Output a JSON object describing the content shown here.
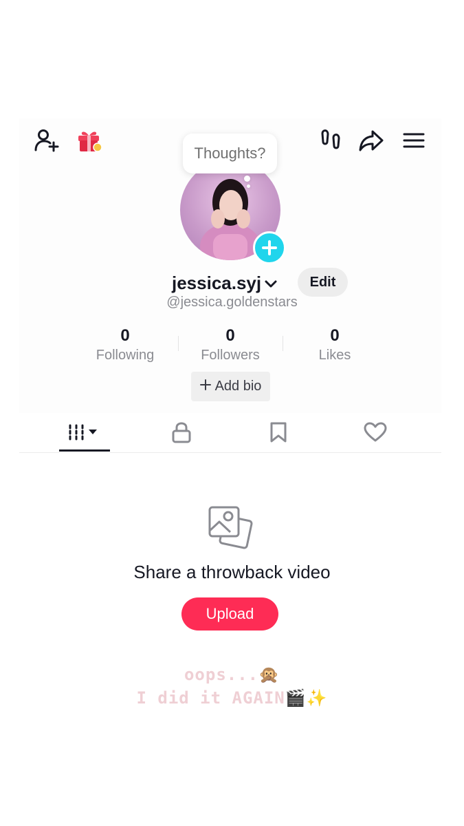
{
  "profile": {
    "thought_bubble": "Thoughts?",
    "username": "jessica.syj",
    "handle": "@jessica.goldenstars",
    "edit_label": "Edit",
    "add_bio_label": "Add bio"
  },
  "stats": [
    {
      "value": "0",
      "label": "Following"
    },
    {
      "value": "0",
      "label": "Followers"
    },
    {
      "value": "0",
      "label": "Likes"
    }
  ],
  "header_icons": [
    "add-user-icon",
    "gift-icon",
    "footprints-icon",
    "share-icon",
    "menu-icon"
  ],
  "tabs": [
    "videos-grid-icon",
    "lock-icon",
    "bookmark-icon",
    "heart-icon"
  ],
  "empty_state": {
    "icon": "photos-icon",
    "title": "Share a throwback video",
    "button_label": "Upload"
  },
  "story_overlay": {
    "line1": "oops...🙊",
    "line2": "I did it AGAIN🎬✨"
  },
  "colors": {
    "accent": "#fe2c55",
    "badge": "#20d5ec",
    "overlay_text": "#efcfd4"
  }
}
